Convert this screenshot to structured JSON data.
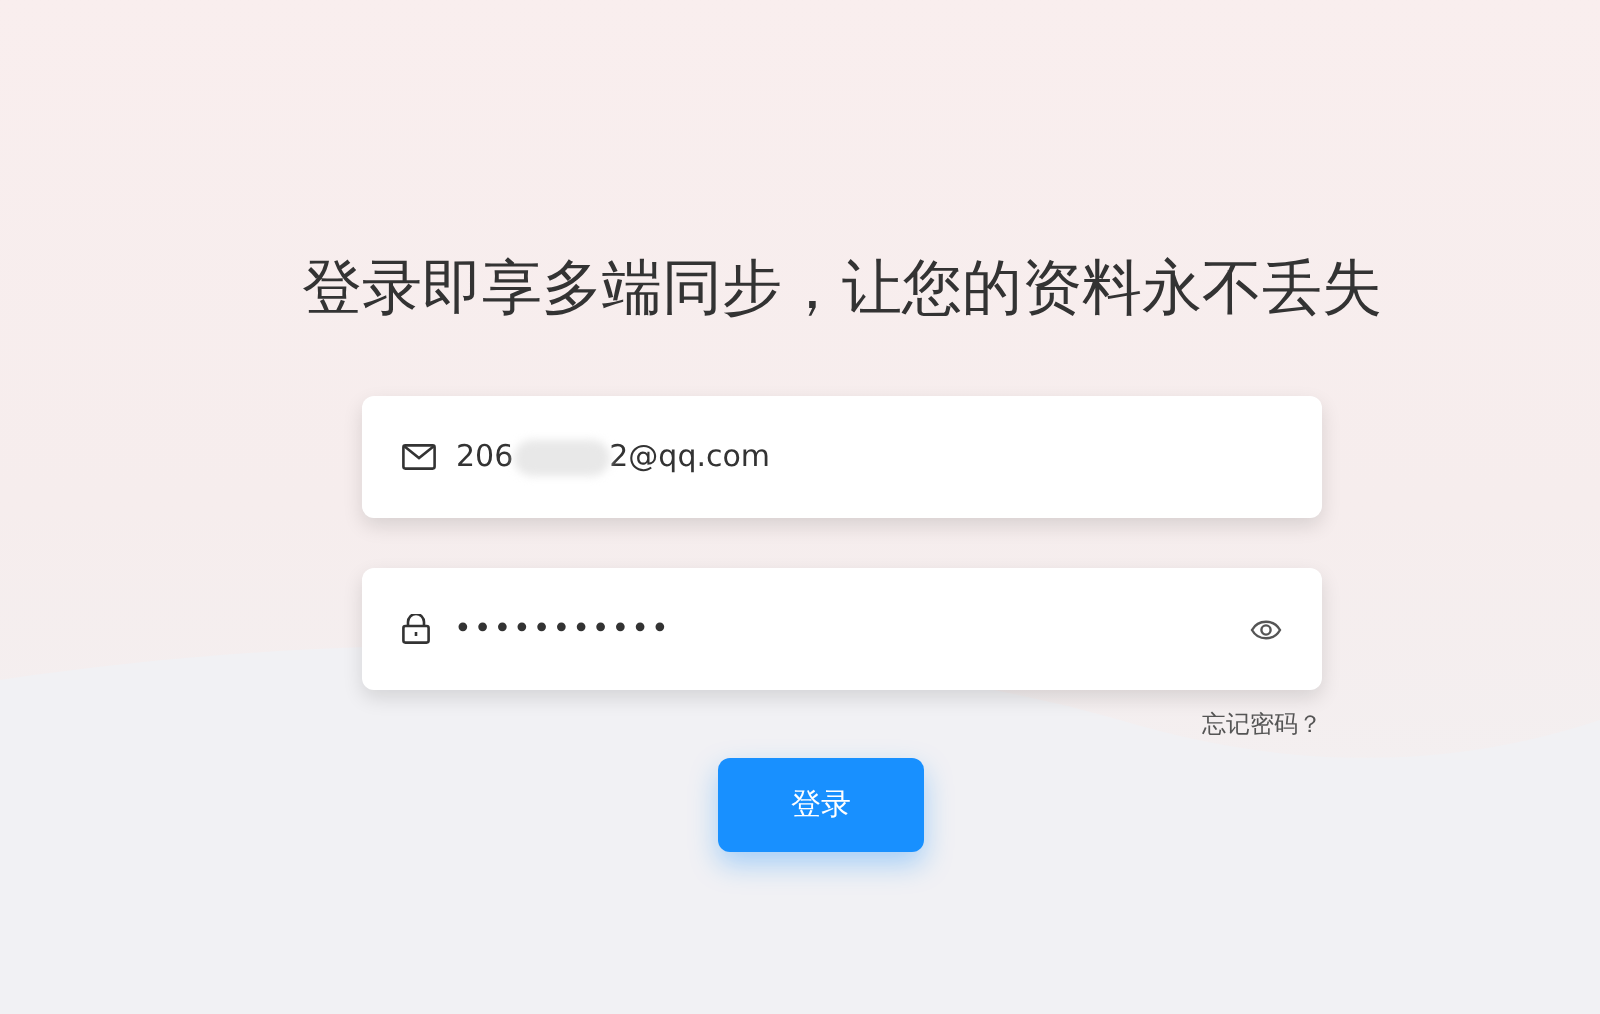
{
  "heading": "登录即享多端同步，让您的资料永不丢失",
  "email_field": {
    "value_start": "206",
    "value_end": "2@qq.com",
    "redacted": true
  },
  "password_field": {
    "value": "•••••••••••"
  },
  "forgot_link": "忘记密码？",
  "login_button": "登录"
}
